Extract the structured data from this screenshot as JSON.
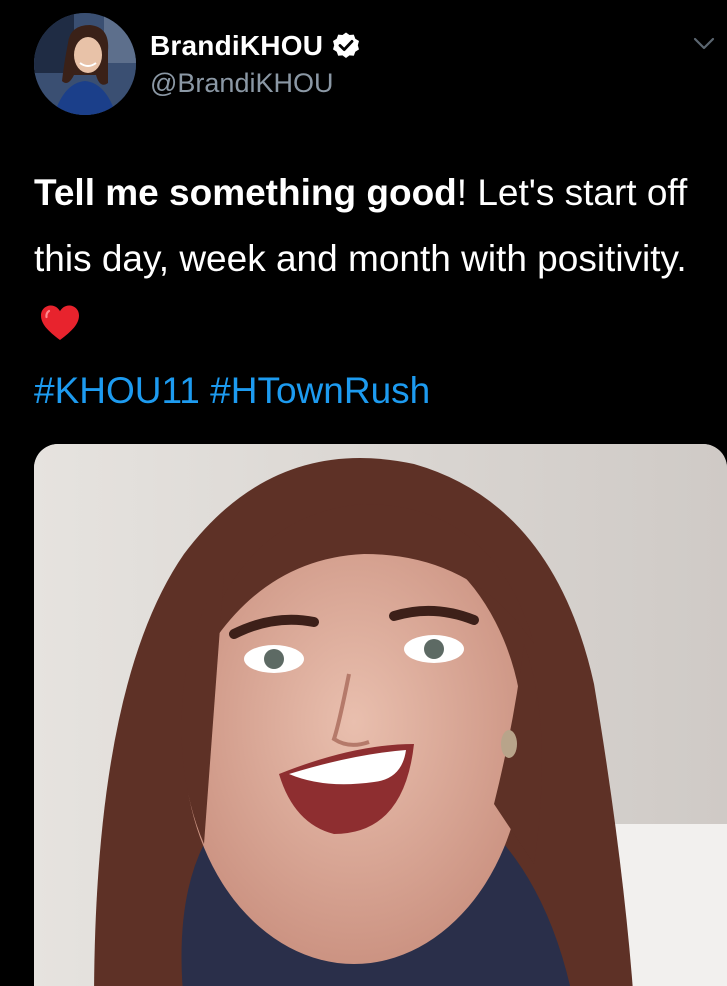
{
  "tweet": {
    "author": {
      "display_name": "BrandiKHOU",
      "handle": "@BrandiKHOU",
      "verified": true,
      "avatar_icon": "profile-photo"
    },
    "menu_icon": "chevron-down-icon",
    "text": {
      "bold_part": "Tell me something good",
      "rest_line": "! Let's start off this day, week and month with positivity.",
      "emoji": "red-heart",
      "hashtags": [
        "#KHOU11",
        "#HTownRush"
      ]
    },
    "media": {
      "type": "video-thumbnail"
    }
  },
  "colors": {
    "background": "#000000",
    "text": "#ffffff",
    "secondary_text": "#8b98a5",
    "link": "#1d9bf0",
    "verified_badge": "#ffffff"
  }
}
